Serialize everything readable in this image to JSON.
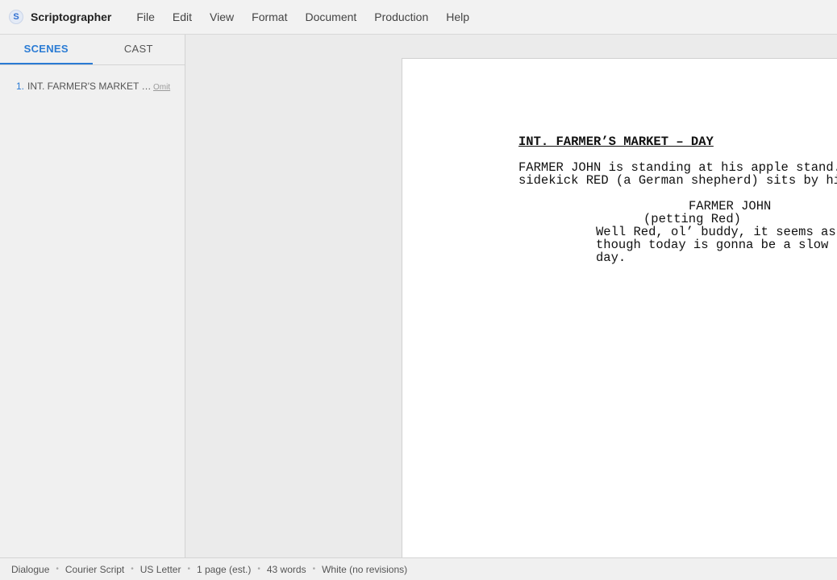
{
  "app": {
    "logo_letter": "S",
    "title": "Scriptographer"
  },
  "menu": [
    "File",
    "Edit",
    "View",
    "Format",
    "Document",
    "Production",
    "Help"
  ],
  "sidebar": {
    "tabs": [
      {
        "label": "SCENES",
        "active": true
      },
      {
        "label": "CAST",
        "active": false
      }
    ],
    "scenes": [
      {
        "number": "1.",
        "title": "INT. FARMER'S MARKET — DAY",
        "omit_label": "Omit"
      }
    ]
  },
  "script": {
    "scene_heading": "INT. FARMER’S MARKET – DAY",
    "action": "FARMER JOHN is standing at his apple stand.\nsidekick RED (a German shepherd) sits by his side.",
    "character": "FARMER JOHN",
    "parenthetical": "(petting Red)",
    "dialogue": "Well Red, ol’ buddy, it seems as\nthough today is gonna be a slow\nday."
  },
  "status": {
    "element_type": "Dialogue",
    "font": "Courier Script",
    "paper": "US Letter",
    "pages": "1 page (est.)",
    "words": "43 words",
    "revision": "White (no revisions)"
  },
  "colors": {
    "accent": "#2a7bd4",
    "page": "#ffffff",
    "background": "#ebebeb"
  }
}
